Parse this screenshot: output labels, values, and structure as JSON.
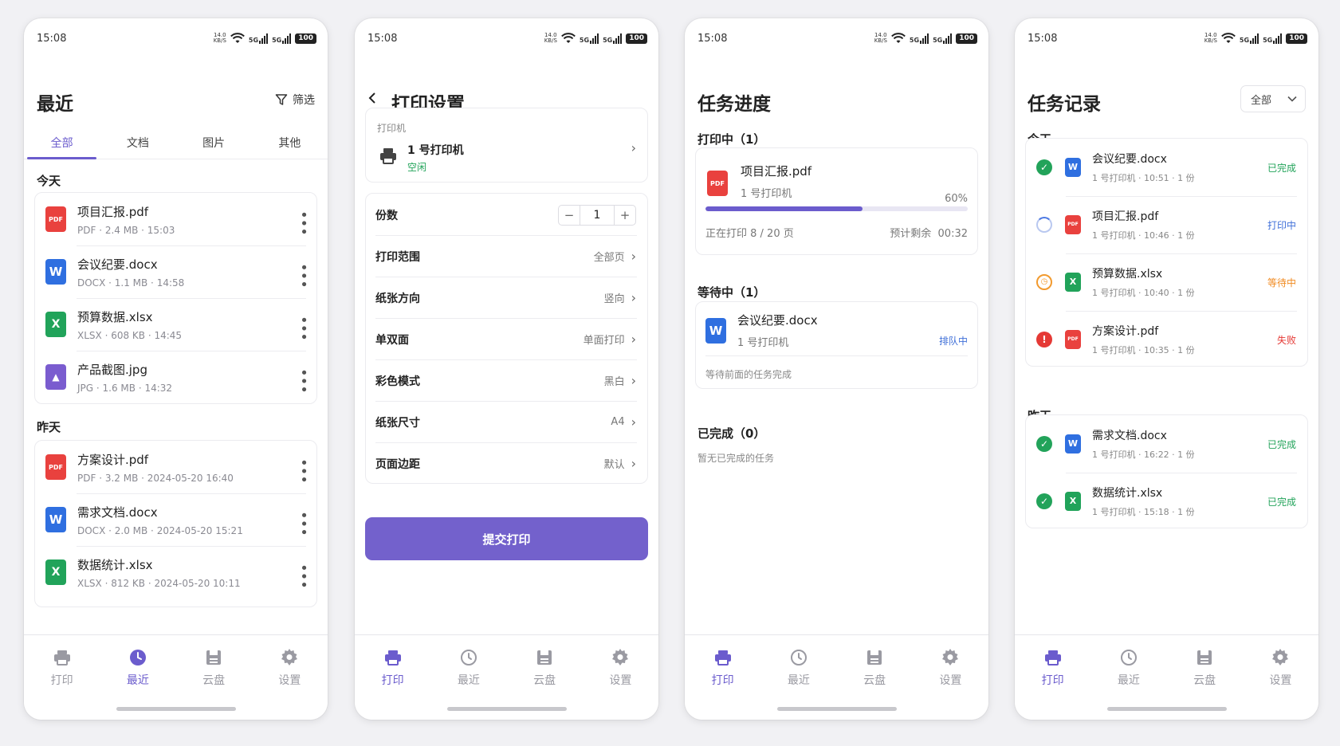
{
  "status": {
    "time": "15:08",
    "speed_top": "14.0",
    "speed_bottom": "KB/S",
    "sig": "5G",
    "battery": "100"
  },
  "nav": [
    {
      "label": "打印",
      "icon": "printer-icon"
    },
    {
      "label": "最近",
      "icon": "clock-icon"
    },
    {
      "label": "云盘",
      "icon": "cloud-disk-icon"
    },
    {
      "label": "设置",
      "icon": "gear-icon"
    }
  ],
  "recent": {
    "title": "最近",
    "filter_label": "筛选",
    "tabs": [
      "全部",
      "文档",
      "图片",
      "其他"
    ],
    "today_label": "今天",
    "yesterday_label": "昨天",
    "today_files": [
      {
        "name": "项目汇报.pdf",
        "type": "PDF",
        "size": "2.4 MB",
        "time": "15:03",
        "icon": "PDF"
      },
      {
        "name": "会议纪要.docx",
        "type": "DOCX",
        "size": "1.1 MB",
        "time": "14:58",
        "icon": "W"
      },
      {
        "name": "预算数据.xlsx",
        "type": "XLSX",
        "size": "608 KB",
        "time": "14:45",
        "icon": "X"
      },
      {
        "name": "产品截图.jpg",
        "type": "JPG",
        "size": "1.6 MB",
        "time": "14:32",
        "icon": "▲"
      }
    ],
    "yesterday_files": [
      {
        "name": "方案设计.pdf",
        "type": "PDF",
        "size": "3.2 MB",
        "time": "2024-05-20 16:40",
        "icon": "PDF"
      },
      {
        "name": "需求文档.docx",
        "type": "DOCX",
        "size": "2.0 MB",
        "time": "2024-05-20 15:21",
        "icon": "W"
      },
      {
        "name": "数据统计.xlsx",
        "type": "XLSX",
        "size": "812 KB",
        "time": "2024-05-20 10:11",
        "icon": "X"
      }
    ]
  },
  "settings": {
    "title": "打印设置",
    "printer_label": "打印机",
    "printer_name": "1 号打印机",
    "printer_status": "空闲",
    "copies_label": "份数",
    "copies_value": "1",
    "rows": [
      {
        "label": "打印范围",
        "value": "全部页"
      },
      {
        "label": "纸张方向",
        "value": "竖向"
      },
      {
        "label": "单双面",
        "value": "单面打印"
      },
      {
        "label": "彩色模式",
        "value": "黑白"
      },
      {
        "label": "纸张尺寸",
        "value": "A4"
      },
      {
        "label": "页面边距",
        "value": "默认"
      }
    ],
    "submit_label": "提交打印"
  },
  "progress": {
    "title": "任务进度",
    "printing_label": "打印中（1）",
    "printing_job": {
      "name": "项目汇报.pdf",
      "printer": "1 号打印机",
      "percent_text": "60%",
      "percent": 0.6,
      "pages": "正在打印 8 / 20 页",
      "remaining_label": "预计剩余",
      "remaining": "00:32"
    },
    "waiting_label": "等待中（1）",
    "waiting_job": {
      "name": "会议纪要.docx",
      "printer": "1 号打印机",
      "status": "排队中",
      "note": "等待前面的任务完成"
    },
    "done_label": "已完成（0）",
    "done_empty": "暂无已完成的任务"
  },
  "records": {
    "title": "任务记录",
    "filter_value": "全部",
    "today_label": "今天",
    "yesterday_label": "昨天",
    "today": [
      {
        "name": "会议纪要.docx",
        "meta": "1 号打印机 · 10:51 · 1 份",
        "status": "已完成",
        "kind": "done",
        "icon": "W"
      },
      {
        "name": "项目汇报.pdf",
        "meta": "1 号打印机 · 10:46 · 1 份",
        "status": "打印中",
        "kind": "print",
        "icon": "PDF"
      },
      {
        "name": "预算数据.xlsx",
        "meta": "1 号打印机 · 10:40 · 1 份",
        "status": "等待中",
        "kind": "wait",
        "icon": "X"
      },
      {
        "name": "方案设计.pdf",
        "meta": "1 号打印机 · 10:35 · 1 份",
        "status": "失败",
        "kind": "fail",
        "icon": "PDF"
      }
    ],
    "yesterday": [
      {
        "name": "需求文档.docx",
        "meta": "1 号打印机 · 16:22 · 1 份",
        "status": "已完成",
        "kind": "done",
        "icon": "W"
      },
      {
        "name": "数据统计.xlsx",
        "meta": "1 号打印机 · 15:18 · 1 份",
        "status": "已完成",
        "kind": "done",
        "icon": "X"
      }
    ]
  }
}
